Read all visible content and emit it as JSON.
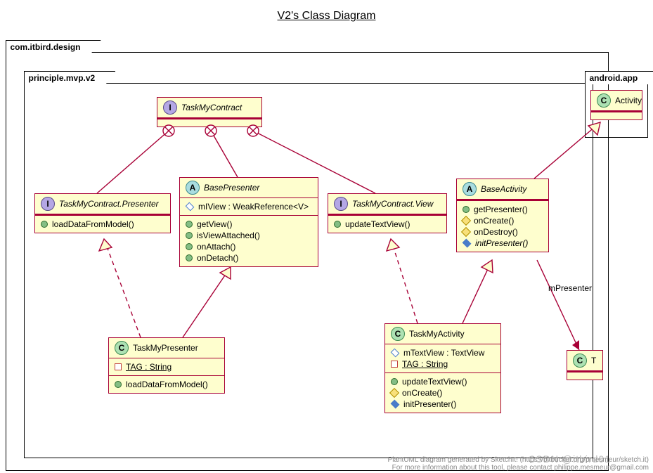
{
  "title": "V2's Class Diagram",
  "packages": {
    "outer": {
      "name": "com.itbird.design"
    },
    "inner": {
      "name": "principle.mvp.v2"
    },
    "android": {
      "name": "android.app"
    }
  },
  "classes": {
    "TaskMyContract": {
      "kind": "I",
      "name": "TaskMyContract"
    },
    "TaskMyContract_Presenter": {
      "kind": "I",
      "name": "TaskMyContract.Presenter",
      "methods": [
        "loadDataFromModel()"
      ]
    },
    "TaskMyContract_View": {
      "kind": "I",
      "name": "TaskMyContract.View",
      "methods": [
        "updateTextView()"
      ]
    },
    "BasePresenter": {
      "kind": "A",
      "name": "BasePresenter",
      "attrs": [
        {
          "vis": "attr",
          "text": "mIView : WeakReference<V>"
        }
      ],
      "methods": [
        "getView()",
        "isViewAttached()",
        "onAttach()",
        "onDetach()"
      ]
    },
    "BaseActivity": {
      "kind": "A",
      "name": "BaseActivity",
      "methods": [
        {
          "vis": "pub",
          "text": "getPresenter()"
        },
        {
          "vis": "prot",
          "text": "onCreate()"
        },
        {
          "vis": "prot",
          "text": "onDestroy()"
        },
        {
          "vis": "attr-fill",
          "text": "initPresenter()",
          "italic": true
        }
      ]
    },
    "TaskMyPresenter": {
      "kind": "C",
      "name": "TaskMyPresenter",
      "attrs": [
        {
          "vis": "priv",
          "text": "TAG : String",
          "underline": true
        }
      ],
      "methods": [
        "loadDataFromModel()"
      ]
    },
    "TaskMyActivity": {
      "kind": "C",
      "name": "TaskMyActivity",
      "attrs": [
        {
          "vis": "attr",
          "text": "mTextView : TextView"
        },
        {
          "vis": "priv",
          "text": "TAG : String",
          "underline": true
        }
      ],
      "methods": [
        {
          "vis": "pub",
          "text": "updateTextView()"
        },
        {
          "vis": "prot",
          "text": "onCreate()"
        },
        {
          "vis": "attr-fill",
          "text": "initPresenter()"
        }
      ]
    },
    "Activity": {
      "kind": "C",
      "name": "Activity"
    },
    "T": {
      "kind": "C",
      "name": "T"
    }
  },
  "relations": [
    {
      "from": "TaskMyContract_Presenter",
      "to": "TaskMyContract",
      "type": "nest"
    },
    {
      "from": "TaskMyContract_View",
      "to": "TaskMyContract",
      "type": "nest"
    },
    {
      "from": "BasePresenter",
      "to": "TaskMyContract",
      "type": "nest"
    },
    {
      "from": "TaskMyPresenter",
      "to": "TaskMyContract_Presenter",
      "type": "realize"
    },
    {
      "from": "TaskMyPresenter",
      "to": "BasePresenter",
      "type": "generalize"
    },
    {
      "from": "TaskMyActivity",
      "to": "TaskMyContract_View",
      "type": "realize"
    },
    {
      "from": "TaskMyActivity",
      "to": "BaseActivity",
      "type": "generalize"
    },
    {
      "from": "BaseActivity",
      "to": "Activity",
      "type": "generalize"
    },
    {
      "from": "BaseActivity",
      "to": "T",
      "type": "assoc",
      "label": "mPresenter"
    }
  ],
  "footer": {
    "line1": "PlantUML diagram generated by SketchIt! (https://bitbucket.org/pmesmeur/sketch.it)",
    "line2": "For more information about this tool, please contact philippe.mesmeur@gmail.com"
  },
  "watermark": "CSDN @itbird01",
  "edge_labels": {
    "mPresenter": "mPresenter"
  }
}
